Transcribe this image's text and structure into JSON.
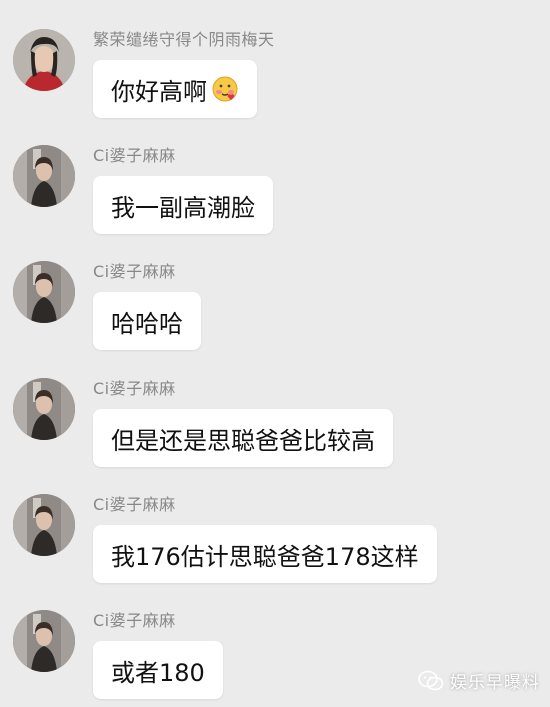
{
  "messages": [
    {
      "sender": "繁荣缱绻守得个阴雨梅天",
      "text": "你好高啊",
      "avatar": "avatar-girl-red",
      "emoji": "blushing-face-icon"
    },
    {
      "sender": "Ci婆子麻麻",
      "text": "我一副高潮脸",
      "avatar": "avatar-girl-street"
    },
    {
      "sender": "Ci婆子麻麻",
      "text": "哈哈哈",
      "avatar": "avatar-girl-street"
    },
    {
      "sender": "Ci婆子麻麻",
      "text": "但是还是思聪爸爸比较高",
      "avatar": "avatar-girl-street"
    },
    {
      "sender": "Ci婆子麻麻",
      "text": "我176估计思聪爸爸178这样",
      "avatar": "avatar-girl-street"
    },
    {
      "sender": "Ci婆子麻麻",
      "text": "或者180",
      "avatar": "avatar-girl-street"
    }
  ],
  "watermark": {
    "text": "娱乐早曝料",
    "icon": "wechat-icon"
  },
  "colors": {
    "background": "#ebebeb",
    "bubble": "#ffffff",
    "sender": "#888888"
  }
}
